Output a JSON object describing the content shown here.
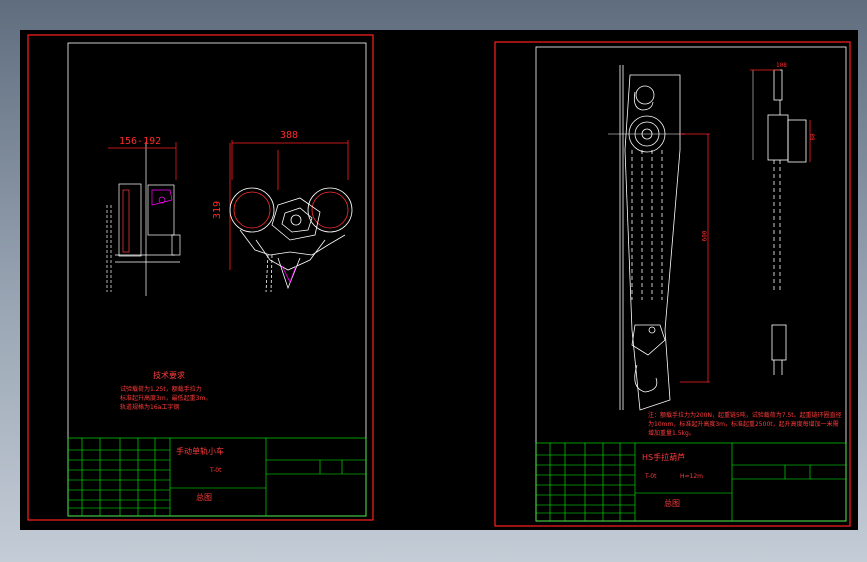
{
  "colors": {
    "background": "#000000",
    "frame": "#ff2020",
    "sheet": "#ffffff",
    "table_lines": "#00ff00",
    "text": "#ff3030",
    "accent": "#ff00ff"
  },
  "left_sheet": {
    "dim_width": "156-192",
    "dim_front": "388",
    "dim_height": "319",
    "tech_title": "技术要求",
    "tech_lines": [
      "试验载荷为1.25t，额载手拉力",
      "标准起升高度3m，最低起重3m。",
      "轨道规格为16a工字钢"
    ],
    "title_block": {
      "name": "手动单轨小车",
      "model": "T-0t",
      "drawing": "总图"
    }
  },
  "right_sheet": {
    "dim_top": "108",
    "dim_side": "88",
    "dim_total": "600",
    "note": "注：额载手拉力为200N，起重链5吨，试验载荷为7.5t。起重链环圈直径为10mm，标准起升高度3m，标准起重2500t，起升高度每增加一米需增加重量1.5kg。",
    "title_block": {
      "name": "HS手拉葫芦",
      "model": "T-0t",
      "spec": "H=12m",
      "drawing": "总图"
    }
  }
}
